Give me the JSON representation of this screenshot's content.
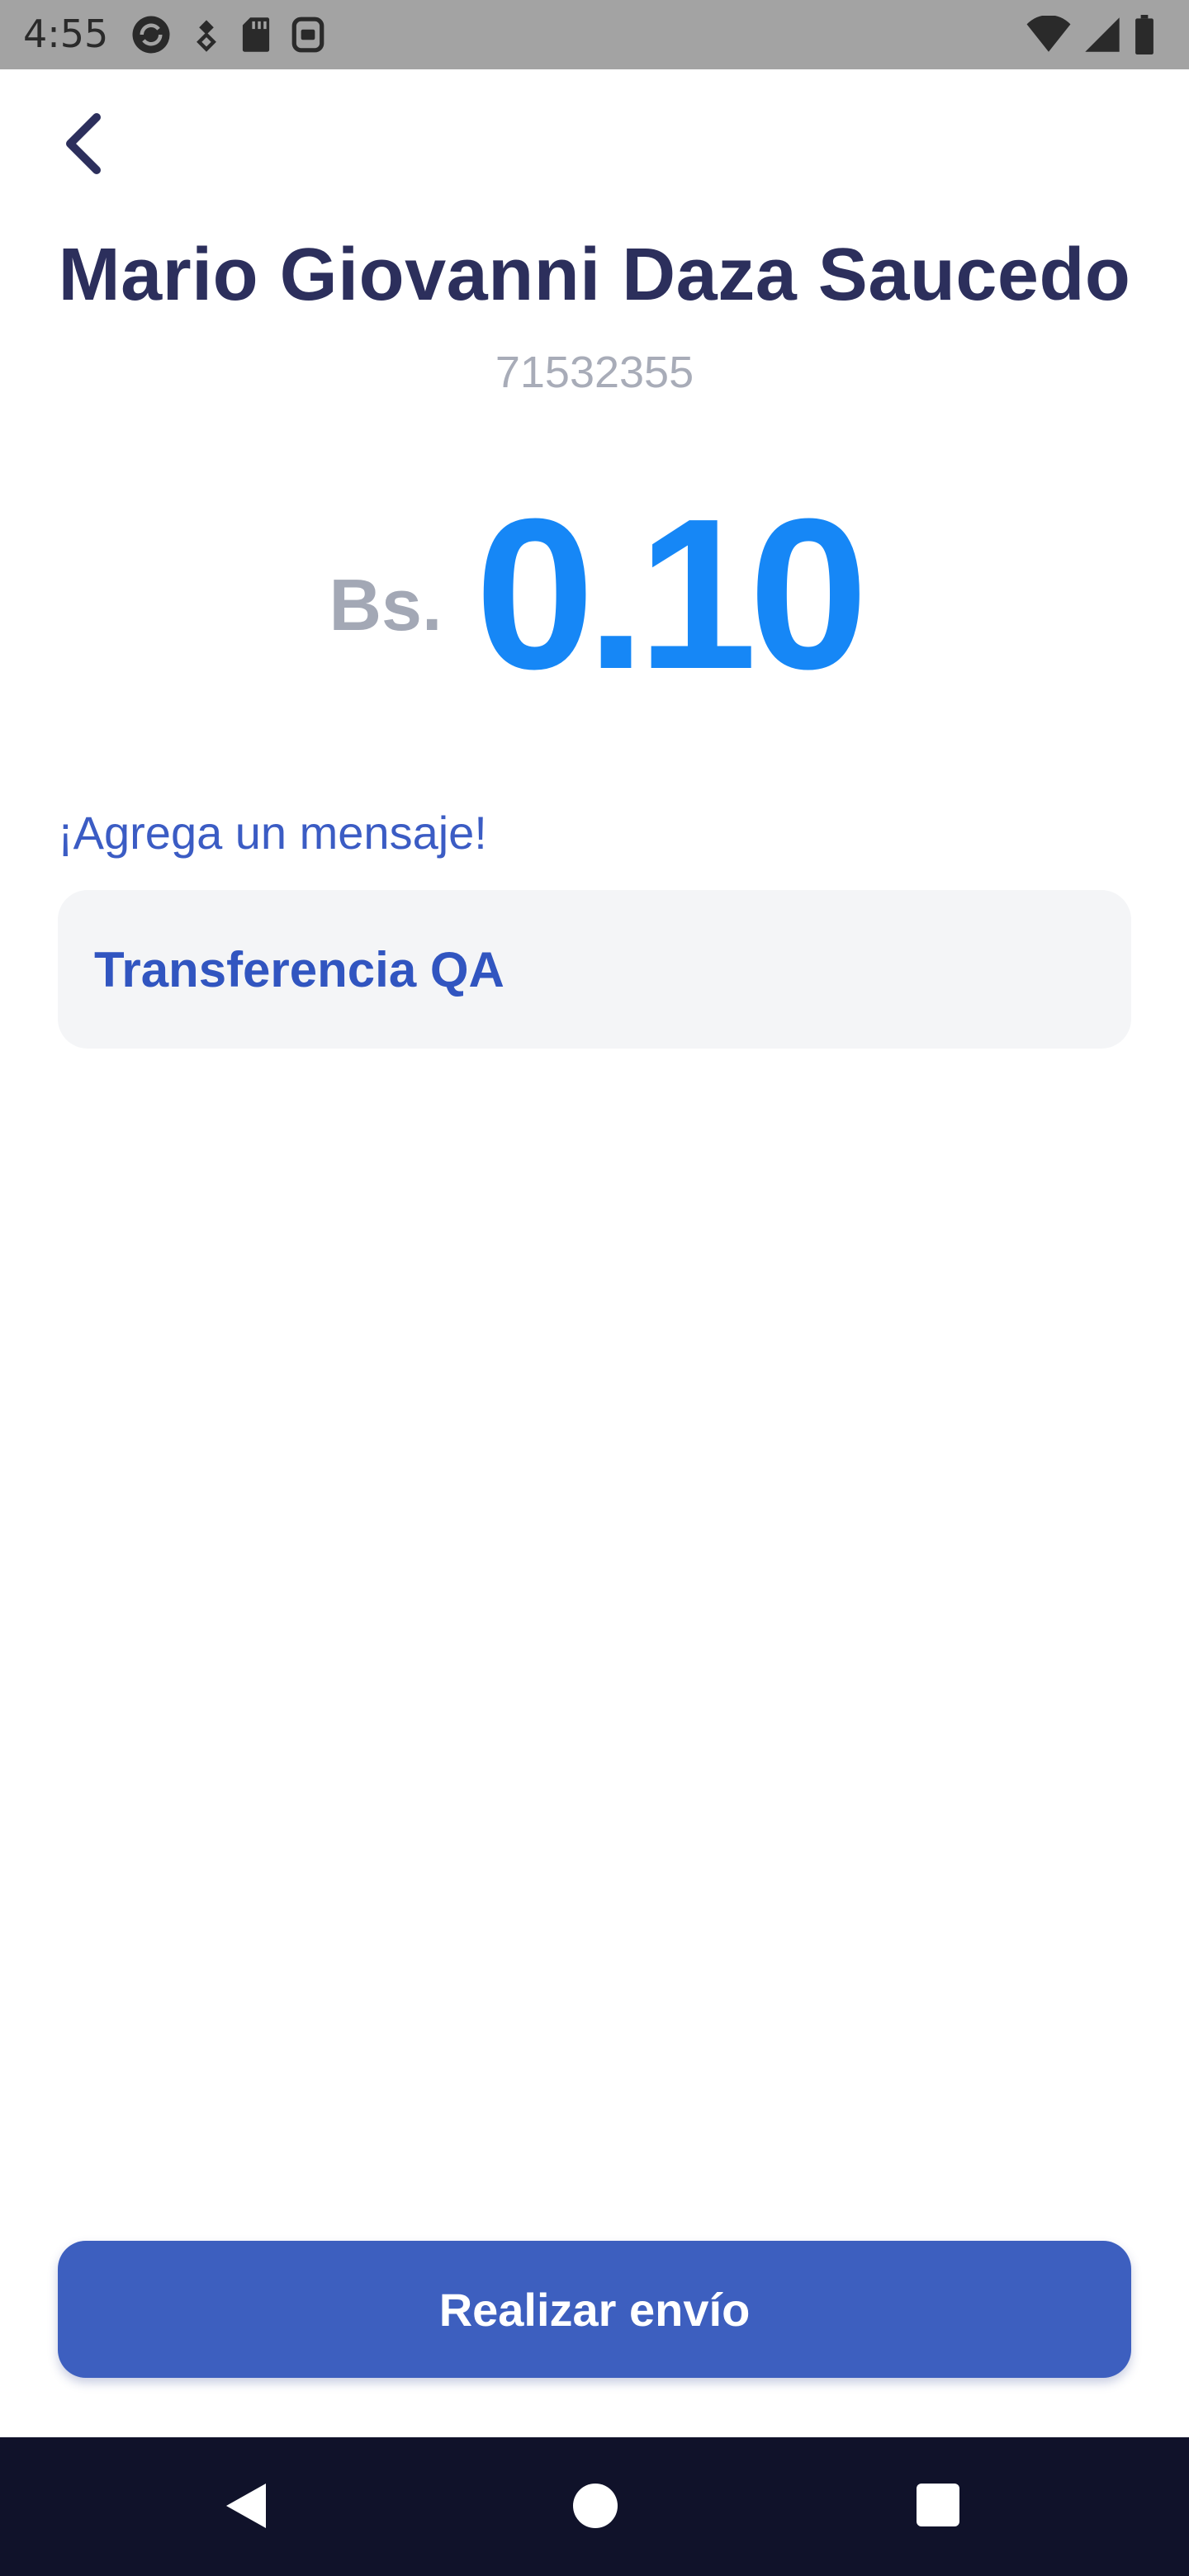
{
  "status_bar": {
    "time": "4:55",
    "left_icons": [
      "sync-icon",
      "vpn-key-icon",
      "sd-card-icon",
      "security-icon"
    ],
    "right_icons": [
      "wifi-icon",
      "cell-signal-icon",
      "battery-icon"
    ]
  },
  "header": {
    "back_icon": "chevron-left-icon"
  },
  "recipient": {
    "name": "Mario Giovanni Daza Saucedo",
    "phone": "71532355"
  },
  "amount": {
    "currency": "Bs.",
    "value": "0.10"
  },
  "message": {
    "label": "¡Agrega un mensaje!",
    "value": "Transferencia QA"
  },
  "actions": {
    "send_label": "Realizar envío"
  },
  "nav_bar": {
    "buttons": [
      "back-triangle-icon",
      "home-circle-icon",
      "recents-square-icon"
    ]
  },
  "colors": {
    "primary": "#3d5fbf",
    "amount": "#1687f6",
    "title": "#2c2f5c",
    "muted": "#a8acb8",
    "status_bar": "#a3a3a3",
    "nav_bar": "#10122a"
  }
}
